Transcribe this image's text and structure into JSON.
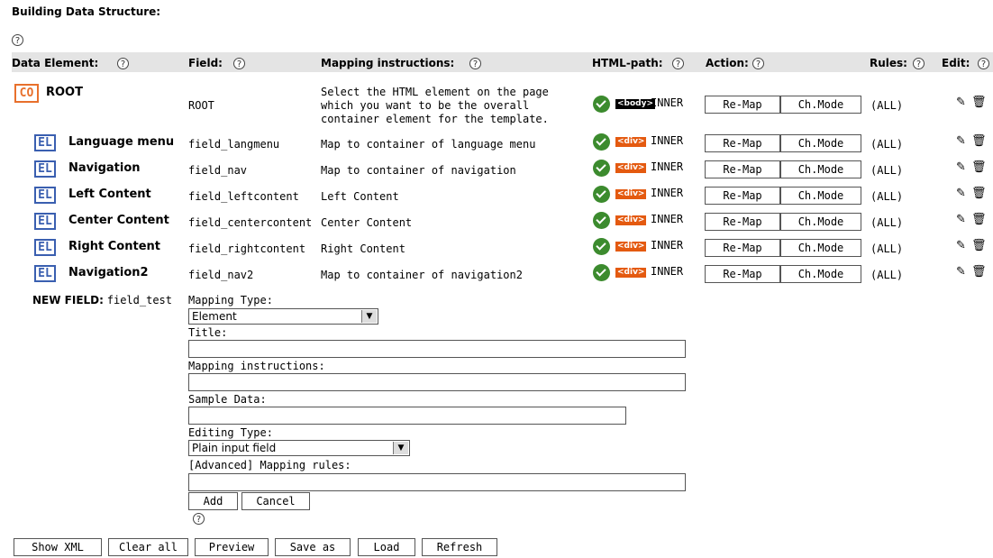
{
  "section_title": "Building Data Structure:",
  "help_glyph": "?",
  "headers": {
    "data_element": "Data Element:",
    "field": "Field:",
    "mapping_instructions": "Mapping instructions:",
    "html_path": "HTML-path:",
    "action": "Action:",
    "rules": "Rules:",
    "edit": "Edit:"
  },
  "rows": [
    {
      "badge": "CO",
      "name": "ROOT",
      "field": "ROOT",
      "instr1": "Select the HTML element on the page",
      "instr2": "which you want to be the overall",
      "instr3": "container element for the template.",
      "tag": "<body>",
      "mode": "INNER",
      "remap": "Re-Map",
      "chmode": "Ch.Mode",
      "rules": "(ALL)"
    },
    {
      "badge": "EL",
      "name": "Language menu",
      "field": "field_langmenu",
      "instr": "Map to container of language menu",
      "tag": "<div>",
      "mode": "INNER",
      "remap": "Re-Map",
      "chmode": "Ch.Mode",
      "rules": "(ALL)"
    },
    {
      "badge": "EL",
      "name": "Navigation",
      "field": "field_nav",
      "instr": "Map to container of navigation",
      "tag": "<div>",
      "mode": "INNER",
      "remap": "Re-Map",
      "chmode": "Ch.Mode",
      "rules": "(ALL)"
    },
    {
      "badge": "EL",
      "name": "Left Content",
      "field": "field_leftcontent",
      "instr": "Left Content",
      "tag": "<div>",
      "mode": "INNER",
      "remap": "Re-Map",
      "chmode": "Ch.Mode",
      "rules": "(ALL)"
    },
    {
      "badge": "EL",
      "name": "Center Content",
      "field": "field_centercontent",
      "instr": "Center Content",
      "tag": "<div>",
      "mode": "INNER",
      "remap": "Re-Map",
      "chmode": "Ch.Mode",
      "rules": "(ALL)"
    },
    {
      "badge": "EL",
      "name": "Right Content",
      "field": "field_rightcontent",
      "instr": "Right Content",
      "tag": "<div>",
      "mode": "INNER",
      "remap": "Re-Map",
      "chmode": "Ch.Mode",
      "rules": "(ALL)"
    },
    {
      "badge": "EL",
      "name": "Navigation2",
      "field": "field_nav2",
      "instr": "Map to container of navigation2",
      "tag": "<div>",
      "mode": "INNER",
      "remap": "Re-Map",
      "chmode": "Ch.Mode",
      "rules": "(ALL)"
    }
  ],
  "new_field": {
    "label": "NEW FIELD:",
    "name": "field_test",
    "mapping_type_label": "Mapping Type:",
    "mapping_type_value": "Element",
    "title_label": "Title:",
    "title_value": "",
    "mapping_instructions_label": "Mapping instructions:",
    "mapping_instructions_value": "",
    "sample_data_label": "Sample Data:",
    "sample_data_value": "",
    "editing_type_label": "Editing Type:",
    "editing_type_value": "Plain input field",
    "advanced_rules_label": "[Advanced] Mapping rules:",
    "advanced_rules_value": "",
    "add_label": "Add",
    "cancel_label": "Cancel"
  },
  "footer_buttons": {
    "show_xml": "Show XML",
    "clear_all": "Clear all",
    "preview": "Preview",
    "save_as": "Save as",
    "load": "Load",
    "refresh": "Refresh"
  },
  "icons": {
    "edit": "pencil-icon",
    "delete": "trash-icon",
    "ok": "check-icon"
  },
  "colors": {
    "container_badge": "#e8702c",
    "element_badge": "#3a5fb0",
    "div_tag": "#e45a10",
    "ok_green": "#3c8b2e",
    "header_bg": "#e4e4e4"
  }
}
